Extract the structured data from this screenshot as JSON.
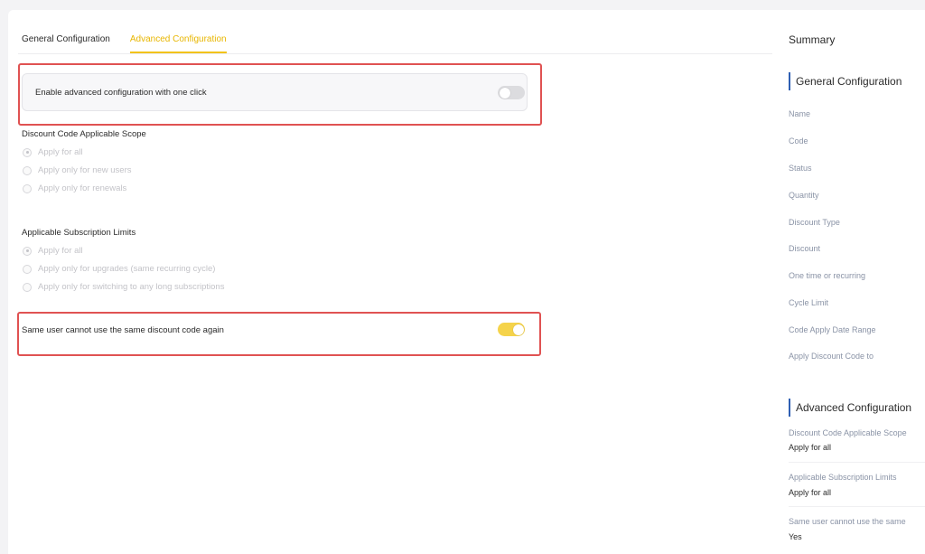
{
  "tabs": [
    {
      "label": "General Configuration",
      "active": false
    },
    {
      "label": "Advanced Configuration",
      "active": true
    }
  ],
  "advanced_toggle": {
    "label": "Enable advanced configuration with one click",
    "on": false
  },
  "scope": {
    "title": "Discount Code Applicable Scope",
    "options": [
      "Apply for all",
      "Apply only for new users",
      "Apply only for renewals"
    ],
    "selected": 0
  },
  "limits": {
    "title": "Applicable Subscription Limits",
    "options": [
      "Apply for all",
      "Apply only for upgrades (same recurring cycle)",
      "Apply only for switching to any long subscriptions"
    ],
    "selected": 0
  },
  "reuse_toggle": {
    "label": "Same user cannot use the same discount code again",
    "on": true
  },
  "summary": {
    "title": "Summary",
    "general": {
      "title": "General Configuration",
      "fields": [
        "Name",
        "Code",
        "Status",
        "Quantity",
        "Discount Type",
        "Discount",
        "One time or recurring",
        "Cycle Limit",
        "Code Apply Date Range",
        "Apply Discount Code to"
      ]
    },
    "advanced": {
      "title": "Advanced Configuration",
      "items": [
        {
          "label": "Discount Code Applicable Scope",
          "value": "Apply for all"
        },
        {
          "label": "Applicable Subscription Limits",
          "value": "Apply for all"
        },
        {
          "label": "Same user cannot use the same",
          "value": "Yes"
        }
      ]
    }
  },
  "colors": {
    "accent": "#f2c318",
    "highlight": "#e05252",
    "section_bar": "#2f5fb3"
  }
}
